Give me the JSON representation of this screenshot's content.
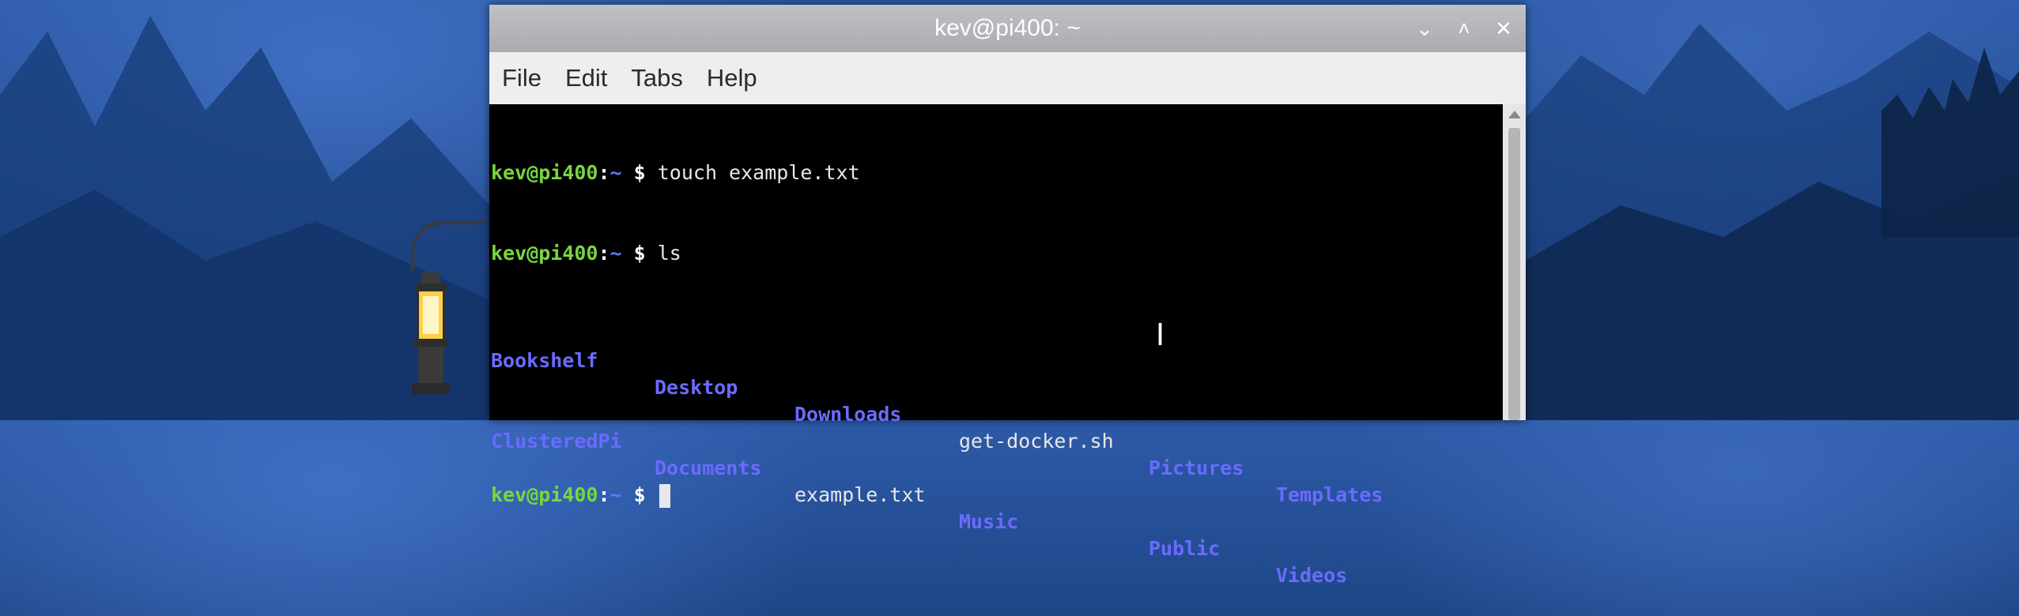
{
  "window": {
    "title": "kev@pi400: ~"
  },
  "title_controls": {
    "minimize": "⌄",
    "maximize": "˄",
    "close": "✕"
  },
  "menu": [
    "File",
    "Edit",
    "Tabs",
    "Help"
  ],
  "terminal": {
    "prompt_user": "kev@pi400",
    "prompt_sep": ":",
    "prompt_path": "~",
    "prompt_dollar": " $ ",
    "commands": [
      "touch example.txt",
      "ls"
    ],
    "ls_row1": [
      {
        "name": "Bookshelf",
        "type": "dir"
      },
      {
        "name": "Desktop",
        "type": "dir"
      },
      {
        "name": "Downloads",
        "type": "dir"
      },
      {
        "name": "get-docker.sh",
        "type": "file"
      },
      {
        "name": "Pictures",
        "type": "dir"
      },
      {
        "name": "Templates",
        "type": "dir"
      }
    ],
    "ls_row2": [
      {
        "name": "ClusteredPi",
        "type": "dir"
      },
      {
        "name": "Documents",
        "type": "dir"
      },
      {
        "name": "example.txt",
        "type": "file"
      },
      {
        "name": "Music",
        "type": "dir"
      },
      {
        "name": "Public",
        "type": "dir"
      },
      {
        "name": "Videos",
        "type": "dir"
      }
    ]
  },
  "colors": {
    "prompt_user": "#78d63f",
    "directory": "#6b6bff",
    "terminal_bg": "#000000"
  }
}
